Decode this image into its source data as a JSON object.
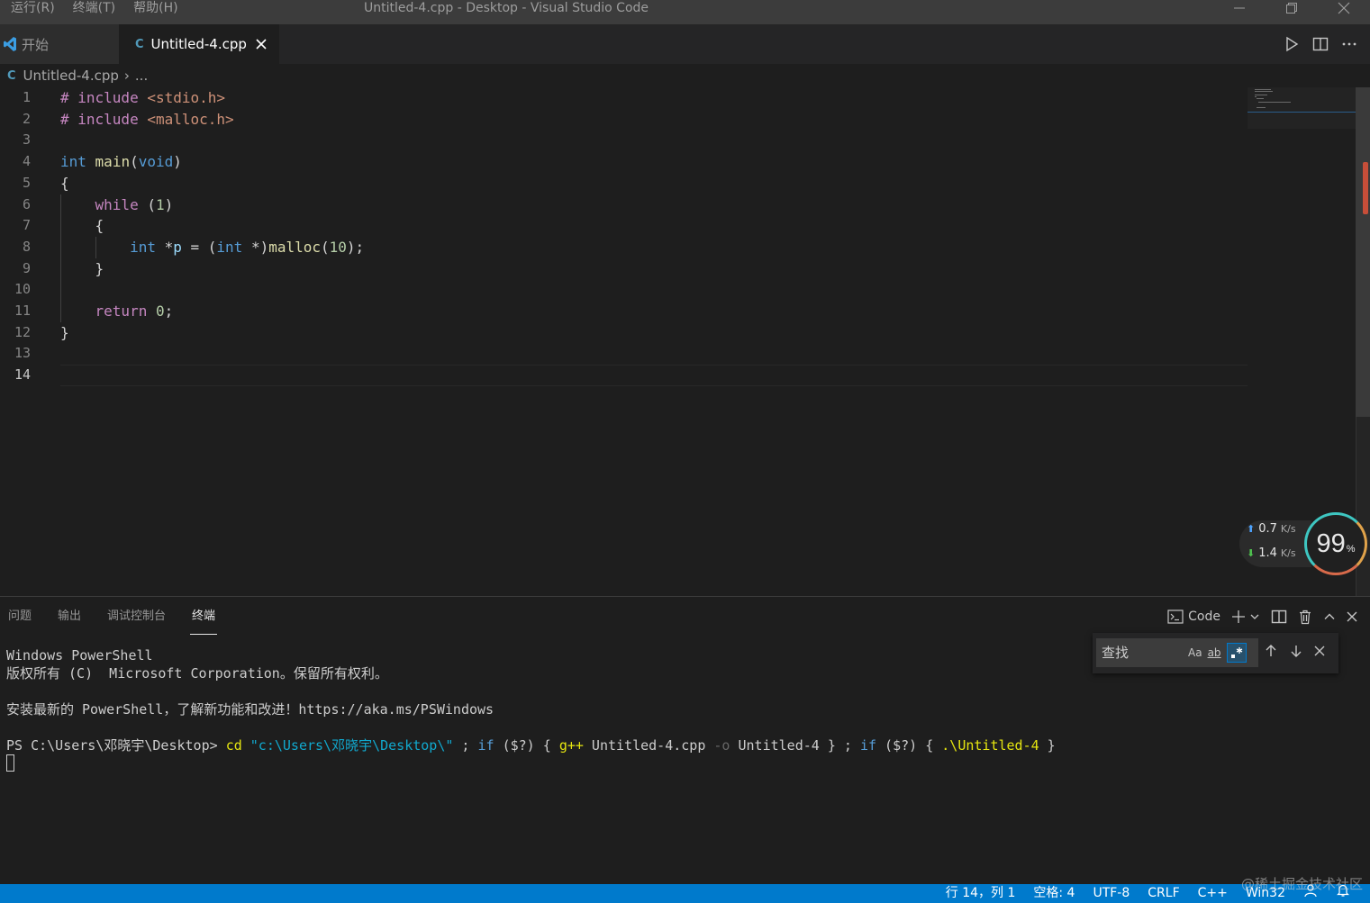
{
  "titlebar": {
    "menu": [
      "运行(R)",
      "终端(T)",
      "帮助(H)"
    ],
    "title": "Untitled-4.cpp - Desktop - Visual Studio Code"
  },
  "tabs": {
    "start_label": "开始",
    "file_label": "Untitled-4.cpp",
    "file_icon": "C"
  },
  "breadcrumb": {
    "file": "Untitled-4.cpp",
    "more": "..."
  },
  "editor": {
    "active_line": 14,
    "line_numbers": [
      "1",
      "2",
      "3",
      "4",
      "5",
      "6",
      "7",
      "8",
      "9",
      "10",
      "11",
      "12",
      "13",
      "14"
    ]
  },
  "network": {
    "upload": "0.7",
    "download": "1.4",
    "unit": "K/s",
    "gauge_value": "99",
    "gauge_unit": "%"
  },
  "panel": {
    "tabs": [
      "问题",
      "输出",
      "调试控制台",
      "终端"
    ],
    "active_tab": "终端",
    "terminal_selector": "Code"
  },
  "find": {
    "placeholder": "查找",
    "match_case": "Aa",
    "whole_word": "ab"
  },
  "terminal": {
    "line1": "Windows PowerShell",
    "line2": "版权所有 (C)  Microsoft Corporation。保留所有权利。",
    "line3": "安装最新的 PowerShell，了解新功能和改进！https://aka.ms/PSWindows",
    "prompt": "PS C:\\Users\\邓晓宇\\Desktop> ",
    "cmd_cd": "cd",
    "cmd_path": "\"c:\\Users\\邓晓宇\\Desktop\\\"",
    "cmd_sep1": " ; ",
    "cmd_if1": "if",
    "cmd_cond1": " ($?) { ",
    "cmd_gpp": "g++",
    "cmd_file": " Untitled-4.cpp ",
    "cmd_flag": "-o",
    "cmd_out": " Untitled-4 } ; ",
    "cmd_if2": "if",
    "cmd_cond2": " ($?) { ",
    "cmd_run": ".\\Untitled-4",
    "cmd_end": " }"
  },
  "statusbar": {
    "position": "行 14，列 1",
    "spaces": "空格: 4",
    "encoding": "UTF-8",
    "eol": "CRLF",
    "language": "C++",
    "platform": "Win32"
  },
  "watermark": "@稀土掘金技术社区",
  "colors": {
    "statusbar": "#007acc",
    "editor_bg": "#1e1e1e",
    "keyword_blue": "#569cd6",
    "keyword_pink": "#c586c0",
    "string": "#ce9178"
  }
}
